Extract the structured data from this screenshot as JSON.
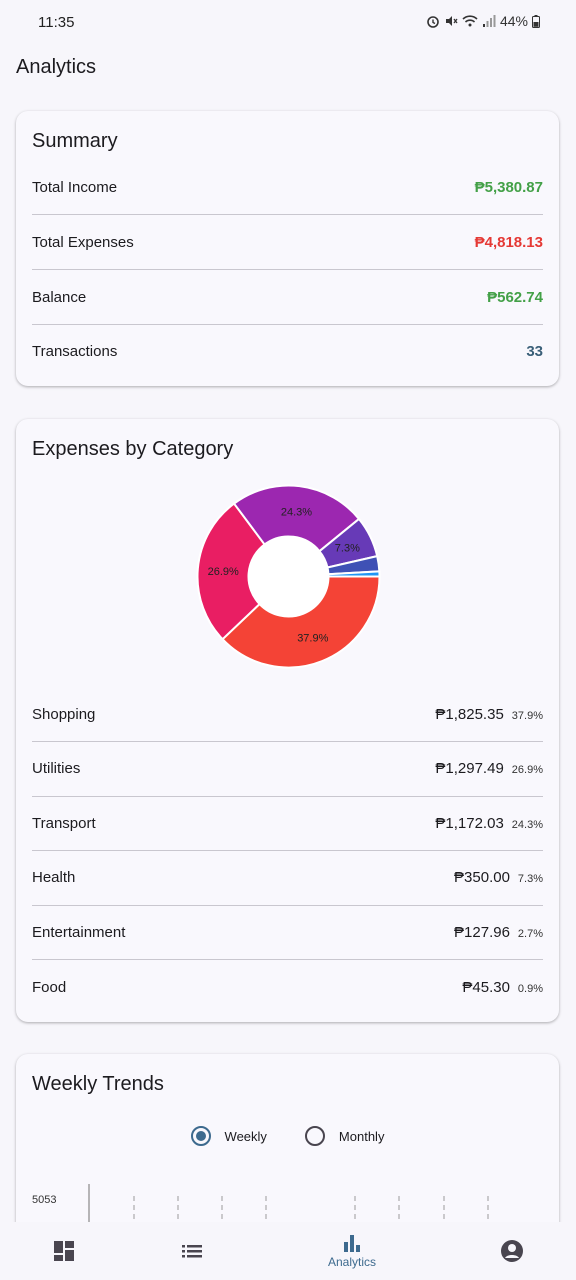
{
  "status": {
    "time": "11:35",
    "battery": "44%"
  },
  "app": {
    "title": "Analytics"
  },
  "summary": {
    "title": "Summary",
    "rows": [
      {
        "label": "Total Income",
        "value": "₱5,380.87",
        "color": "#43a047"
      },
      {
        "label": "Total Expenses",
        "value": "₱4,818.13",
        "color": "#e53935"
      },
      {
        "label": "Balance",
        "value": "₱562.74",
        "color": "#43a047"
      },
      {
        "label": "Transactions",
        "value": "33",
        "color": "#3a5f78"
      }
    ]
  },
  "categories": {
    "title": "Expenses by Category",
    "items": [
      {
        "name": "Shopping",
        "amount": "₱1,825.35",
        "pct": "37.9%"
      },
      {
        "name": "Utilities",
        "amount": "₱1,297.49",
        "pct": "26.9%"
      },
      {
        "name": "Transport",
        "amount": "₱1,172.03",
        "pct": "24.3%"
      },
      {
        "name": "Health",
        "amount": "₱350.00",
        "pct": "7.3%"
      },
      {
        "name": "Entertainment",
        "amount": "₱127.96",
        "pct": "2.7%"
      },
      {
        "name": "Food",
        "amount": "₱45.30",
        "pct": "0.9%"
      }
    ]
  },
  "chart_data": {
    "type": "pie",
    "categories": [
      "Shopping",
      "Utilities",
      "Transport",
      "Health",
      "Entertainment",
      "Food"
    ],
    "values": [
      37.9,
      26.9,
      24.3,
      7.3,
      2.7,
      0.9
    ],
    "labels": [
      "37.9%",
      "26.9%",
      "24.3%",
      "7.3%",
      "",
      ""
    ],
    "colors": [
      "#f44336",
      "#e91e63",
      "#9c27b0",
      "#673ab7",
      "#3f51b5",
      "#2196f3"
    ],
    "donut": true
  },
  "trends": {
    "title": "Weekly Trends",
    "options": [
      "Weekly",
      "Monthly"
    ],
    "selected": "Weekly",
    "y_top_tick": "5053"
  },
  "nav": {
    "items": [
      {
        "icon": "dashboard-icon",
        "label": ""
      },
      {
        "icon": "list-icon",
        "label": ""
      },
      {
        "icon": "analytics-icon",
        "label": "Analytics"
      },
      {
        "icon": "account-icon",
        "label": ""
      }
    ],
    "active": "Analytics",
    "accent": "#3d6a8e"
  }
}
